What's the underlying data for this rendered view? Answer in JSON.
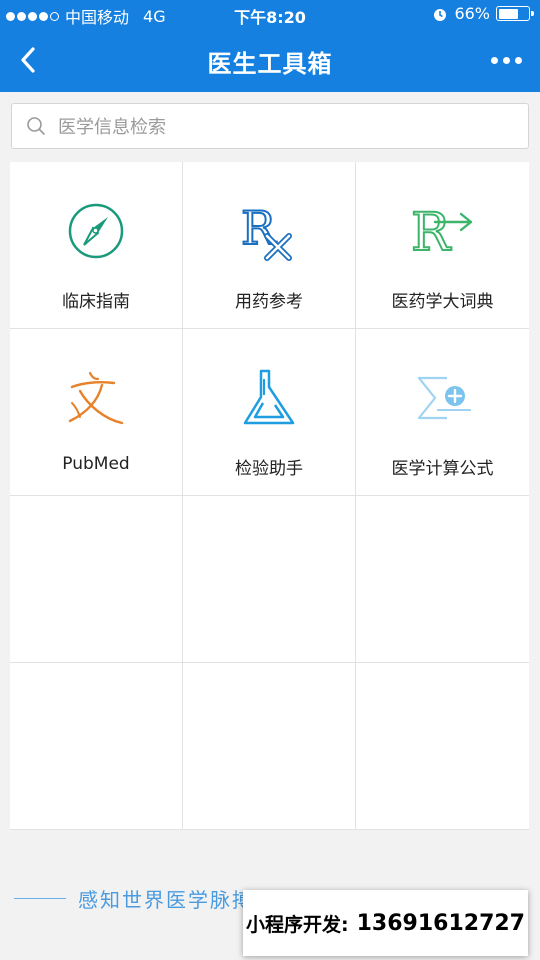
{
  "status_bar": {
    "carrier": "中国移动",
    "network": "4G",
    "time": "下午8:20",
    "battery": "66%",
    "battery_level": 0.66
  },
  "nav": {
    "title": "医生工具箱",
    "back_icon": "chevron-left-icon",
    "more_icon": "more-dots-icon"
  },
  "search": {
    "placeholder": "医学信息检索"
  },
  "tools": [
    {
      "label": "临床指南",
      "icon": "compass-icon"
    },
    {
      "label": "用药参考",
      "icon": "rx-icon"
    },
    {
      "label": "医药学大词典",
      "icon": "dictionary-r-icon"
    },
    {
      "label": "PubMed",
      "icon": "pubmed-icon"
    },
    {
      "label": "检验助手",
      "icon": "flask-icon"
    },
    {
      "label": "医学计算公式",
      "icon": "sigma-plus-icon"
    }
  ],
  "slogan": "感知世界医学脉搏",
  "promo": {
    "label": "小程序开发:",
    "phone": "13691612727"
  },
  "colors": {
    "brand": "#1580e0",
    "compass": "#1a9a7a",
    "rx": "#1a6fc0",
    "dictionary": "#3cb56a",
    "pubmed": "#e8822a",
    "flask": "#1e9ee0",
    "sigma": "#7cc4ee"
  }
}
